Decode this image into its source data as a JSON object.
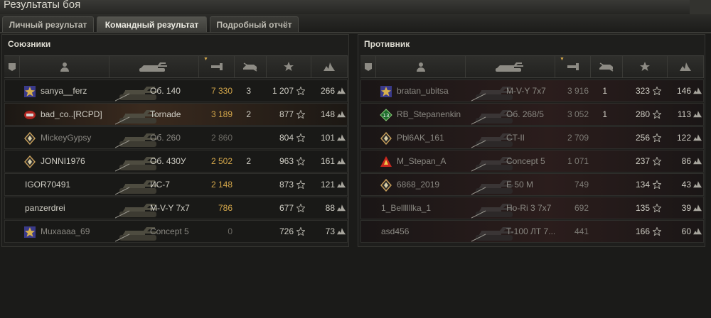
{
  "window": {
    "title": "Результаты боя"
  },
  "tabs": [
    {
      "label": "Личный результат",
      "active": false
    },
    {
      "label": "Командный результат",
      "active": true
    },
    {
      "label": "Подробный отчёт",
      "active": false
    }
  ],
  "allies": {
    "title": "Союзники",
    "rows": [
      {
        "player": "sanya__ferz",
        "tank": "Об. 140",
        "damage": "7 330",
        "kills": "3",
        "xp": "1 207",
        "rating": "266",
        "badge": "clan-emblem",
        "dead": false
      },
      {
        "player": "bad_co..[RCPD]",
        "tank": "Tornade",
        "damage": "3 189",
        "kills": "2",
        "xp": "877",
        "rating": "148",
        "badge": "clan-emblem-red",
        "dead": false,
        "self": true
      },
      {
        "player": "MickeyGypsy",
        "tank": "Об. 260",
        "damage": "2 860",
        "kills": "",
        "xp": "804",
        "rating": "101",
        "badge": "rank-diamond",
        "dead": true
      },
      {
        "player": "JONNI1976",
        "tank": "Об. 430У",
        "damage": "2 502",
        "kills": "2",
        "xp": "963",
        "rating": "161",
        "badge": "rank-diamond",
        "dead": false
      },
      {
        "player": "IGOR70491",
        "tank": "ИС-7",
        "damage": "2 148",
        "kills": "",
        "xp": "873",
        "rating": "121",
        "badge": "",
        "dead": false
      },
      {
        "player": "panzerdrei",
        "tank": "M-V-Y 7x7",
        "damage": "786",
        "kills": "",
        "xp": "677",
        "rating": "88",
        "badge": "",
        "dead": false
      },
      {
        "player": "Muxaaaa_69",
        "tank": "Concept 5",
        "damage": "0",
        "kills": "",
        "xp": "726",
        "rating": "73",
        "badge": "clan-emblem",
        "dead": true
      }
    ]
  },
  "enemies": {
    "title": "Противник",
    "rows": [
      {
        "player": "bratan_ubitsa",
        "tank": "M-V-Y 7x7",
        "damage": "3 916",
        "kills": "1",
        "xp": "323",
        "rating": "146",
        "badge": "clan-emblem",
        "dead": true
      },
      {
        "player": "RB_Stepanenkin",
        "tank": "Об. 268/5",
        "damage": "3 052",
        "kills": "1",
        "xp": "280",
        "rating": "113",
        "badge": "rank-13",
        "dead": true
      },
      {
        "player": "Pbl6AK_161",
        "tank": "CT-II",
        "damage": "2 709",
        "kills": "",
        "xp": "256",
        "rating": "122",
        "badge": "rank-diamond",
        "dead": true
      },
      {
        "player": "M_Stepan_A",
        "tank": "Concept 5",
        "damage": "1 071",
        "kills": "",
        "xp": "237",
        "rating": "86",
        "badge": "rank-triangle",
        "dead": true
      },
      {
        "player": "6868_2019",
        "tank": "E 50 M",
        "damage": "749",
        "kills": "",
        "xp": "134",
        "rating": "43",
        "badge": "rank-diamond",
        "dead": true
      },
      {
        "player": "1_Bellllllka_1",
        "tank": "Ho-Ri 3 7x7",
        "damage": "692",
        "kills": "",
        "xp": "135",
        "rating": "39",
        "badge": "",
        "dead": true
      },
      {
        "player": "asd456",
        "tank": "T-100 ЛТ 7...",
        "damage": "441",
        "kills": "",
        "xp": "166",
        "rating": "60",
        "badge": "",
        "dead": true
      }
    ]
  },
  "columns": [
    {
      "icon": "platoon-icon"
    },
    {
      "icon": "player-icon"
    },
    {
      "icon": "tank-icon"
    },
    {
      "icon": "damage-icon"
    },
    {
      "icon": "kills-icon"
    },
    {
      "icon": "xp-star-icon"
    },
    {
      "icon": "rating-icon"
    }
  ],
  "colors": {
    "damage": "#d3a64a",
    "accent_tab": "#55554f",
    "enemy_row": "#2b1d1c"
  }
}
